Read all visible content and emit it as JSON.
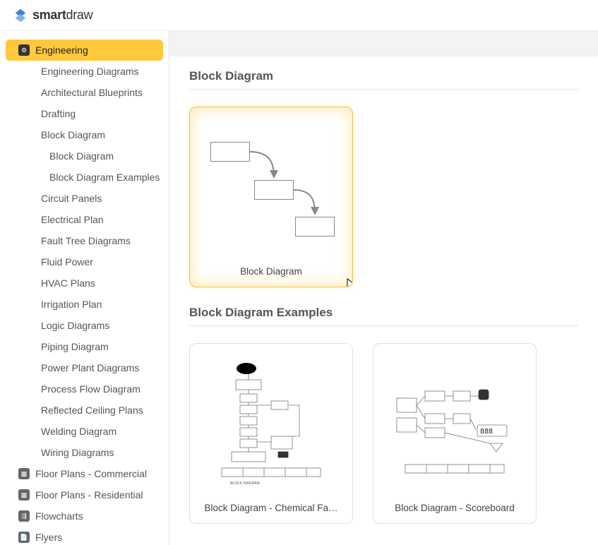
{
  "brand": {
    "name_bold": "smart",
    "name_light": "draw"
  },
  "sidebar": {
    "active_category": "Engineering",
    "engineering_items": [
      "Engineering Diagrams",
      "Architectural Blueprints",
      "Drafting",
      "Block Diagram",
      "Circuit Panels",
      "Electrical Plan",
      "Fault Tree Diagrams",
      "Fluid Power",
      "HVAC Plans",
      "Irrigation Plan",
      "Logic Diagrams",
      "Piping Diagram",
      "Power Plant Diagrams",
      "Process Flow Diagram",
      "Reflected Ceiling Plans",
      "Welding Diagram",
      "Wiring Diagrams"
    ],
    "block_diagram_sub": [
      "Block Diagram",
      "Block Diagram Examples"
    ],
    "other_categories": [
      "Floor Plans - Commercial",
      "Floor Plans - Residential",
      "Flowcharts",
      "Flyers"
    ]
  },
  "content": {
    "section1_title": "Block Diagram",
    "section2_title": "Block Diagram Examples",
    "templates": {
      "main": {
        "label": "Block Diagram"
      },
      "ex1": {
        "label": "Block Diagram - Chemical Fa…"
      },
      "ex2": {
        "label": "Block Diagram - Scoreboard"
      }
    }
  }
}
